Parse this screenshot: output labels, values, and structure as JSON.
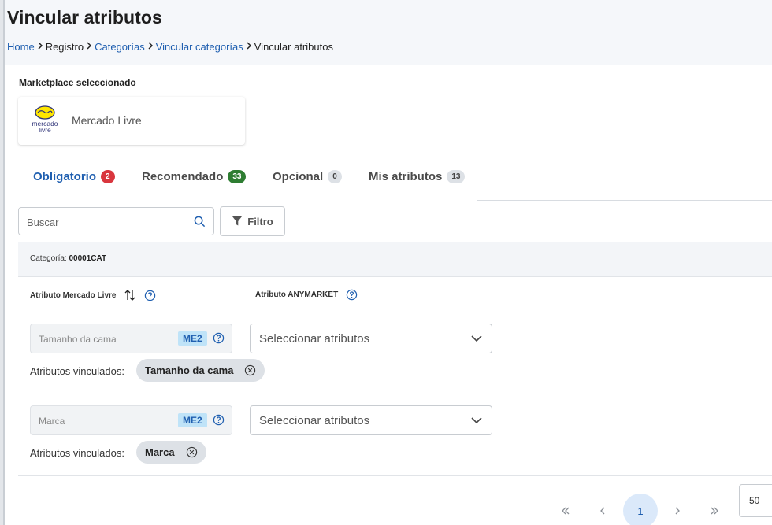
{
  "header": {
    "title": "Vincular atributos",
    "breadcrumb": [
      {
        "label": "Home",
        "link": true
      },
      {
        "label": "Registro",
        "link": false
      },
      {
        "label": "Categorías",
        "link": true
      },
      {
        "label": "Vincular categorías",
        "link": true
      },
      {
        "label": "Vincular atributos",
        "link": false
      }
    ]
  },
  "marketplace": {
    "label": "Marketplace seleccionado",
    "name": "Mercado Livre",
    "logo_text_1": "mercado",
    "logo_text_2": "livre"
  },
  "tabs": [
    {
      "label": "Obligatorio",
      "count": "2",
      "badge_color": "#d9363e",
      "active": true
    },
    {
      "label": "Recomendado",
      "count": "33",
      "badge_color": "#2e7d32",
      "active": false
    },
    {
      "label": "Opcional",
      "count": "0",
      "badge_color": "#dde1e6",
      "active": false
    },
    {
      "label": "Mis atributos",
      "count": "13",
      "badge_color": "#dde1e6",
      "active": false
    }
  ],
  "search": {
    "placeholder": "Buscar"
  },
  "filter": {
    "label": "Filtro"
  },
  "table": {
    "category_label": "Categoría:",
    "category_value": "00001CAT",
    "col_marketplace": "Atributo Mercado Livre",
    "col_anymarket": "Atributo ANYMARKET",
    "linked_label": "Atributos vinculados:",
    "rows": [
      {
        "attribute": "Tamanho da cama",
        "tag": "ME2",
        "select_placeholder": "Seleccionar atributos",
        "linked_chip": "Tamanho da cama"
      },
      {
        "attribute": "Marca",
        "tag": "ME2",
        "select_placeholder": "Seleccionar atributos",
        "linked_chip": "Marca"
      }
    ]
  },
  "pagination": {
    "current_page": "1",
    "per_page": "50"
  },
  "colors": {
    "accent": "#1f5fb0",
    "me2_bg": "#bfe3f8"
  }
}
